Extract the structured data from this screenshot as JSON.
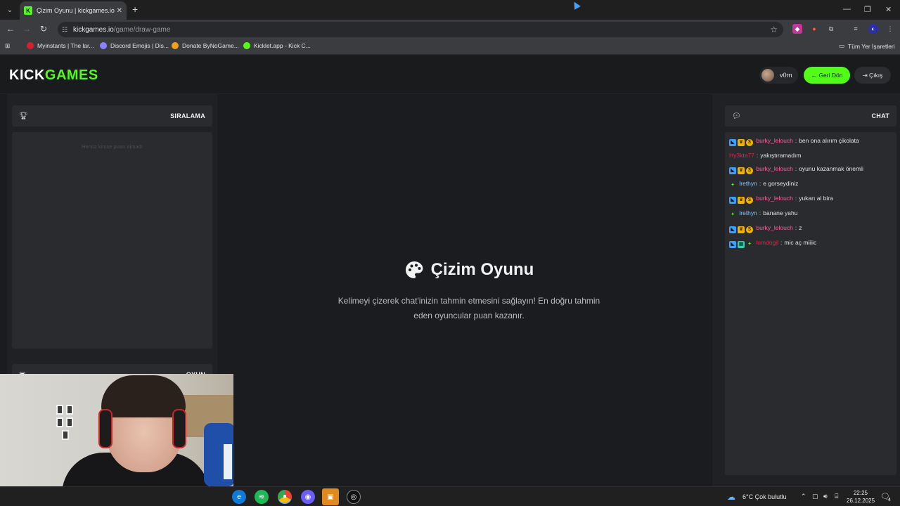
{
  "browser": {
    "tab": {
      "title": "Çizim Oyunu | kickgames.io"
    },
    "address": {
      "host": "kickgames.io",
      "path": "/game/draw-game"
    },
    "bookmarks": [
      {
        "label": "Myinstants | The lar...",
        "color": "#d6202a"
      },
      {
        "label": "Discord Emojis | Dis...",
        "color": "#8b80ff"
      },
      {
        "label": "Donate ByNoGame...",
        "color": "#f0a020"
      },
      {
        "label": "Kicklet.app - Kick C...",
        "color": "#53fc18"
      }
    ],
    "all_bookmarks": "Tüm Yer İşaretleri"
  },
  "header": {
    "logo_kick": "KICK",
    "logo_games": "GAMES",
    "username": "v0rn",
    "back_label": "← Geri Dön",
    "exit_label": "⇥ Çıkış"
  },
  "leaderboard": {
    "title": "SIRALAMA",
    "empty": "Henüz kimse puan almadı"
  },
  "game_panel": {
    "title": "OYUN"
  },
  "game": {
    "title": "Çizim Oyunu",
    "description": "Kelimeyi çizerek chat'inizin tahmin etmesini sağlayın! En doğru tahmin eden oyuncular puan kazanır."
  },
  "chat": {
    "title": "CHAT",
    "messages": [
      {
        "user": "burky_lelouch",
        "text": "ben ona alırım çikolata",
        "color": "#ff5fa2",
        "badges": [
          "#3aa0ff",
          "#f0b400",
          "#f0b400"
        ]
      },
      {
        "user": "Hy3kta77",
        "text": "yakıştıramadım",
        "color": "#d42a4a",
        "badges": []
      },
      {
        "user": "burky_lelouch",
        "text": "oyunu kazanmak önemli",
        "color": "#ff5fa2",
        "badges": [
          "#3aa0ff",
          "#f0b400",
          "#f0b400"
        ]
      },
      {
        "user": "lrethyn",
        "text": "e gorseydiniz",
        "color": "#7ec8ff",
        "badges": [
          "#53fc18"
        ]
      },
      {
        "user": "burky_lelouch",
        "text": "yukarı al bira",
        "color": "#ff5fa2",
        "badges": [
          "#3aa0ff",
          "#f0b400",
          "#f0b400"
        ]
      },
      {
        "user": "lrethyn",
        "text": "banane yahu",
        "color": "#7ec8ff",
        "badges": [
          "#53fc18"
        ]
      },
      {
        "user": "burky_lelouch",
        "text": "z",
        "color": "#ff5fa2",
        "badges": [
          "#3aa0ff",
          "#f0b400",
          "#f0b400"
        ]
      },
      {
        "user": "lomdogil",
        "text": "mic aç miiiic",
        "color": "#d42a4a",
        "badges": [
          "#3aa0ff",
          "#2fd0b0",
          "#53fc18"
        ]
      }
    ]
  },
  "taskbar": {
    "weather": "6°C  Çok bulutlu",
    "time": "22:25",
    "date": "26.12.2025",
    "notifications": "4"
  }
}
